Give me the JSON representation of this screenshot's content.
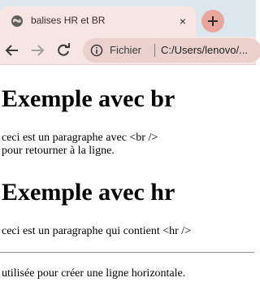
{
  "browser": {
    "tab": {
      "title": "balises HR et BR",
      "close_glyph": "×"
    },
    "newtab_glyph": "+",
    "address": {
      "scheme_label": "Fichier",
      "url": "C:/Users/lenovo/..."
    },
    "icons": {
      "favicon": "globe-icon",
      "back": "arrow-left-icon",
      "forward": "arrow-right-icon",
      "reload": "reload-icon",
      "info": "info-icon",
      "newtab": "plus-icon"
    },
    "colors": {
      "tabbar": "#dbe6ef",
      "tab": "#f7e5e2",
      "omnibox": "#ead1cc",
      "newtab_button": "#e8a79b"
    }
  },
  "content": {
    "heading1": "Exemple avec br",
    "para1_line1": "ceci est un paragraphe avec <br />",
    "para1_line2": "pour retourner à la ligne.",
    "heading2": "Exemple avec hr",
    "para2": "ceci est un paragraphe qui contient <hr />",
    "para3": "utilisée pour créer une ligne horizontale."
  }
}
